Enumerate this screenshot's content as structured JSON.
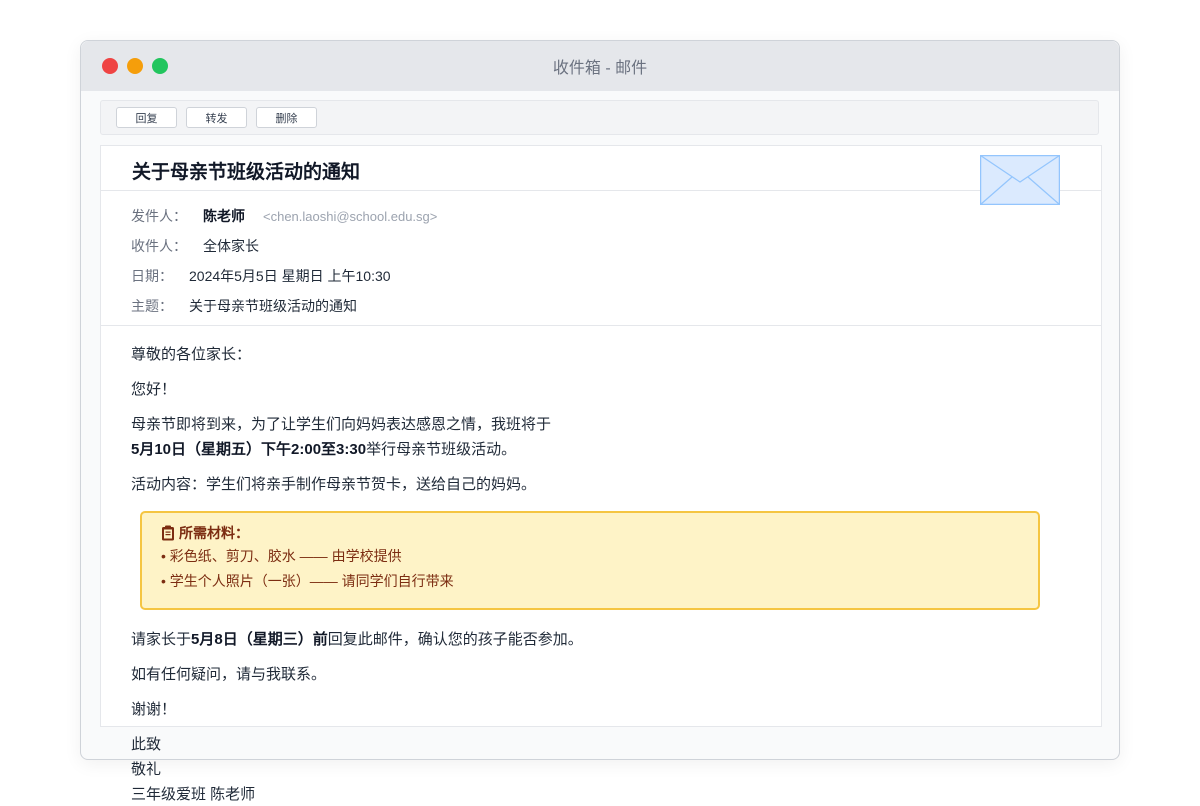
{
  "window": {
    "title": "收件箱 - 邮件"
  },
  "toolbar": {
    "reply": "回复",
    "forward": "转发",
    "delete": "删除"
  },
  "email": {
    "subject": "关于母亲节班级活动的通知",
    "meta": {
      "from_label": "发件人：",
      "from_name": "陈老师",
      "from_email": "<chen.laoshi@school.edu.sg>",
      "to_label": "收件人：",
      "to_value": "全体家长",
      "date_label": "日期：",
      "date_value": "2024年5月5日 星期日 上午10:30",
      "subject_label": "主题：",
      "subject_value": "关于母亲节班级活动的通知"
    },
    "body": {
      "greeting": "尊敬的各位家长：",
      "hello": "您好！",
      "intro_1": "母亲节即将到来，为了让学生们向妈妈表达感恩之情，我班将于",
      "intro_2_bold": "5月10日（星期五）下午2:00至3:30",
      "intro_2_rest": "举行母亲节班级活动。",
      "activity": "活动内容：学生们将亲手制作母亲节贺卡，送给自己的妈妈。",
      "materials": {
        "title": "所需材料：",
        "items": [
          "• 彩色纸、剪刀、胶水 —— 由学校提供",
          "• 学生个人照片（一张）—— 请同学们自行带来"
        ]
      },
      "reply_pre": "请家长于",
      "reply_bold": "5月8日（星期三）前",
      "reply_post": "回复此邮件，确认您的孩子能否参加。",
      "questions": "如有任何疑问，请与我联系。",
      "thanks": "谢谢！",
      "closing_1": "此致",
      "closing_2": "敬礼",
      "signature": "三年级爱班 陈老师"
    }
  },
  "colors": {
    "close": "#ef4444",
    "minimize": "#f59e0b",
    "maximize": "#22c55e",
    "callout_bg": "#fef3c7",
    "callout_border": "#f5c542",
    "callout_text": "#7c2d12"
  }
}
